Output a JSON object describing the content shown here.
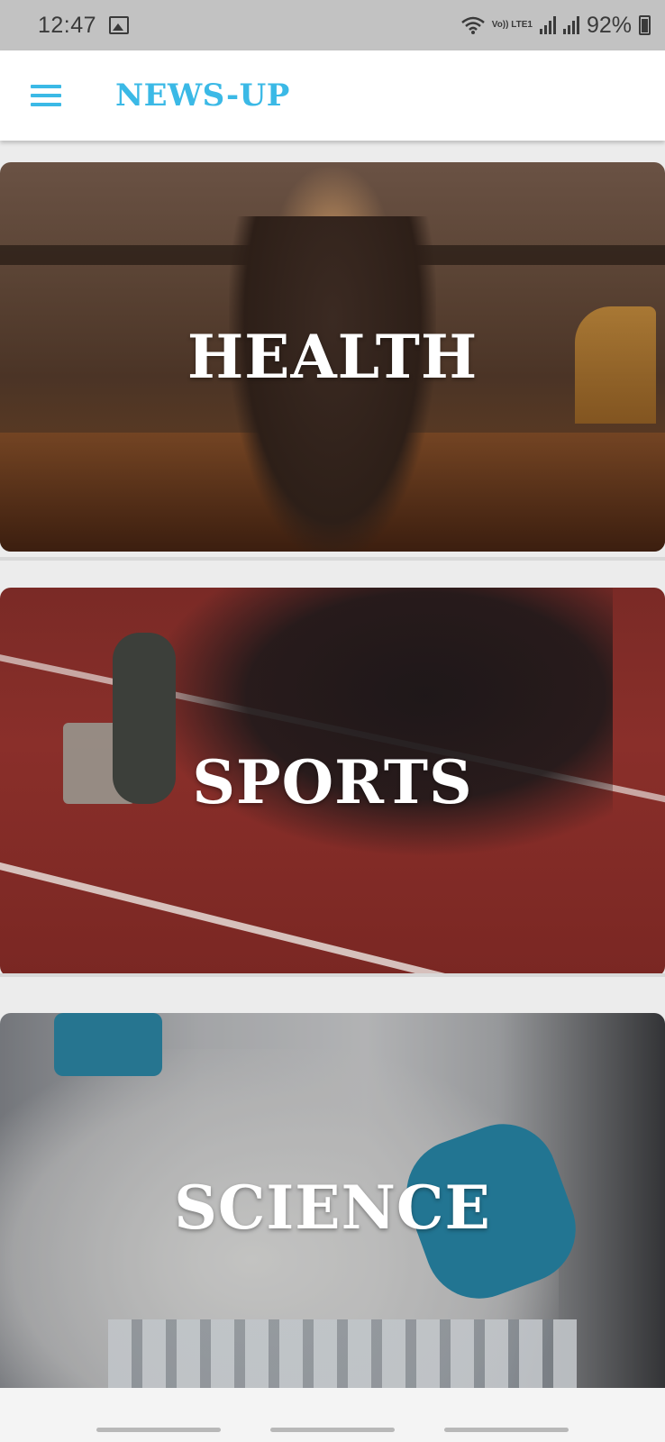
{
  "status_bar": {
    "time": "12:47",
    "network": "Vo)) LTE1",
    "battery": "92%",
    "icons": [
      "image-icon",
      "wifi-icon",
      "signal-icon",
      "signal-icon",
      "battery-charging-icon"
    ]
  },
  "app_bar": {
    "title": "NEWS-UP",
    "menu_icon": "hamburger-menu-icon",
    "accent_color": "#3bb9e6"
  },
  "categories": [
    {
      "label": "HEALTH"
    },
    {
      "label": "SPORTS"
    },
    {
      "label": "SCIENCE"
    }
  ]
}
